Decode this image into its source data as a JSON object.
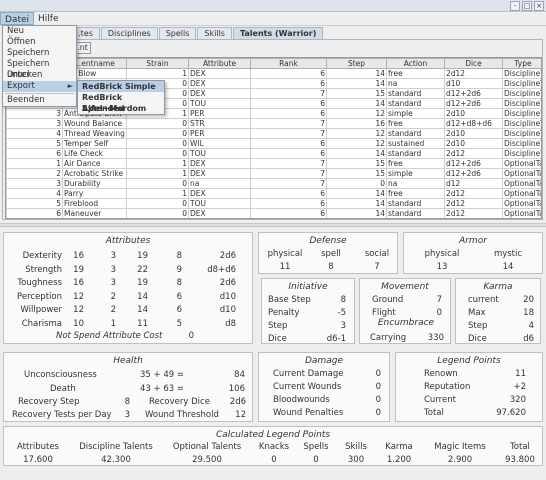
{
  "window": {
    "minimize": "-",
    "maximize": "□",
    "close": "×"
  },
  "menubar": {
    "items": [
      "Datei",
      "Hilfe"
    ]
  },
  "file_menu": {
    "items": [
      {
        "label": "Neu"
      },
      {
        "label": "Öffnen"
      },
      {
        "label": "Speichern"
      },
      {
        "label": "Speichern unter"
      },
      {
        "label": "Drucken"
      },
      {
        "label": "Export"
      },
      {
        "label": "Beenden"
      }
    ],
    "export_submenu": [
      "RedBrick Simple",
      "RedBrick Extended",
      "Ajfel+Mordom"
    ]
  },
  "tabs": [
    "...tes",
    "Disciplines",
    "Spells",
    "Skills",
    "Talents (Warrior)"
  ],
  "add_button": "...nt",
  "talents_table": {
    "headers": [
      "",
      "...entname",
      "Strain",
      "Attribute",
      "Rank",
      "Step",
      "Action",
      "Dice",
      "Type"
    ],
    "rows": [
      [
        "",
        "...d Blow",
        "1",
        "DEX",
        "6",
        "14",
        "free",
        "2d12",
        "DisciplineTalent"
      ],
      [
        "",
        "",
        "0",
        "DEX",
        "6",
        "14",
        "na",
        "d10",
        "DisciplineTalent"
      ],
      [
        "",
        "",
        "0",
        "DEX",
        "7",
        "15",
        "standard",
        "d12+2d6",
        "DisciplineTalent"
      ],
      [
        "",
        "",
        "0",
        "TOU",
        "6",
        "14",
        "standard",
        "d12+2d6",
        "DisciplineTalent"
      ],
      [
        "3",
        "Anticipate Blow",
        "1",
        "PER",
        "6",
        "12",
        "simple",
        "2d10",
        "DisciplineTalent"
      ],
      [
        "3",
        "Wound Balance",
        "0",
        "STR",
        "7",
        "16",
        "free",
        "d12+d8+d6",
        "DisciplineTalent"
      ],
      [
        "4",
        "Thread Weaving",
        "0",
        "PER",
        "7",
        "12",
        "standard",
        "2d10",
        "DisciplineTalent"
      ],
      [
        "5",
        "Temper Self",
        "0",
        "WIL",
        "6",
        "12",
        "sustained",
        "2d10",
        "DisciplineTalent"
      ],
      [
        "6",
        "Life Check",
        "0",
        "TOU",
        "6",
        "14",
        "standard",
        "2d12",
        "DisciplineTalent"
      ],
      [
        "1",
        "Air Dance",
        "1",
        "DEX",
        "7",
        "15",
        "free",
        "d12+2d6",
        "OptionalTalent"
      ],
      [
        "2",
        "Acrobatic Strike",
        "1",
        "DEX",
        "7",
        "15",
        "simple",
        "d12+2d6",
        "OptionalTalent"
      ],
      [
        "3",
        "Durability",
        "0",
        "na",
        "7",
        "0",
        "na",
        "d12",
        "OptionalTalent"
      ],
      [
        "4",
        "Parry",
        "1",
        "DEX",
        "6",
        "14",
        "free",
        "2d12",
        "OptionalTalent"
      ],
      [
        "5",
        "Fireblood",
        "0",
        "TOU",
        "6",
        "14",
        "standard",
        "2d12",
        "OptionalTalent"
      ],
      [
        "6",
        "Maneuver",
        "0",
        "DEX",
        "6",
        "14",
        "standard",
        "2d12",
        "OptionalTalent"
      ]
    ]
  },
  "attributes": {
    "title": "Attributes",
    "rows": [
      [
        "Dexterity",
        "16",
        "3",
        "19",
        "8",
        "2d6"
      ],
      [
        "Strength",
        "19",
        "3",
        "22",
        "9",
        "d8+d6"
      ],
      [
        "Toughness",
        "16",
        "3",
        "19",
        "8",
        "2d6"
      ],
      [
        "Perception",
        "12",
        "2",
        "14",
        "6",
        "d10"
      ],
      [
        "Willpower",
        "12",
        "2",
        "14",
        "6",
        "d10"
      ],
      [
        "Charisma",
        "10",
        "1",
        "11",
        "5",
        "d8"
      ]
    ],
    "footer_label": "Not Spend Attribute Cost",
    "footer_value": "0"
  },
  "defense": {
    "title": "Defense",
    "labels": [
      "physical",
      "spell",
      "social"
    ],
    "values": [
      "11",
      "8",
      "7"
    ]
  },
  "armor": {
    "title": "Armor",
    "labels": [
      "physical",
      "mystic"
    ],
    "values": [
      "13",
      "14"
    ]
  },
  "initiative": {
    "title": "Initiative",
    "rows": [
      [
        "Base Step",
        "8"
      ],
      [
        "Penalty",
        "-5"
      ],
      [
        "Step",
        "3"
      ],
      [
        "Dice",
        "d6-1"
      ]
    ]
  },
  "movement": {
    "title": "Movement",
    "rows": [
      [
        "Ground",
        "7"
      ],
      [
        "Flight",
        "0"
      ]
    ],
    "encumbrance_title": "Encumbrace",
    "carrying_label": "Carrying",
    "carrying_value": "330"
  },
  "karma": {
    "title": "Karma",
    "rows": [
      [
        "current",
        "20"
      ],
      [
        "Max",
        "18"
      ],
      [
        "Step",
        "4"
      ],
      [
        "Dice",
        "d6"
      ]
    ]
  },
  "health": {
    "title": "Health",
    "unconsciousness_label": "Unconsciousness",
    "unconsciousness_formula": "35 + 49 =",
    "unconsciousness_value": "84",
    "death_label": "Death",
    "death_formula": "43 + 63 =",
    "death_value": "106",
    "recovery_step_label": "Recovery Step",
    "recovery_step_value": "8",
    "recovery_dice_label": "Recovery Dice",
    "recovery_dice_value": "2d6",
    "recovery_tests_label": "Recovery Tests per Day",
    "recovery_tests_value": "3",
    "wound_threshold_label": "Wound Threshold",
    "wound_threshold_value": "12"
  },
  "damage": {
    "title": "Damage",
    "rows": [
      [
        "Current Damage",
        "0"
      ],
      [
        "Current Wounds",
        "0"
      ],
      [
        "Bloodwounds",
        "0"
      ],
      [
        "Wound Penalties",
        "0"
      ]
    ]
  },
  "legend_points": {
    "title": "Legend Points",
    "rows": [
      [
        "Renown",
        "11"
      ],
      [
        "Reputation",
        "+2"
      ],
      [
        "Current",
        "320"
      ],
      [
        "Total",
        "97.620"
      ]
    ]
  },
  "calculated": {
    "title": "Calculated Legend Points",
    "headers": [
      "Attributes",
      "Discipline Talents",
      "Optional Talents",
      "Knacks",
      "Spells",
      "Skills",
      "Karma",
      "Magic Items",
      "Total"
    ],
    "values": [
      "17.600",
      "42.300",
      "29.500",
      "0",
      "0",
      "300",
      "1.200",
      "2.900",
      "93.800"
    ]
  }
}
